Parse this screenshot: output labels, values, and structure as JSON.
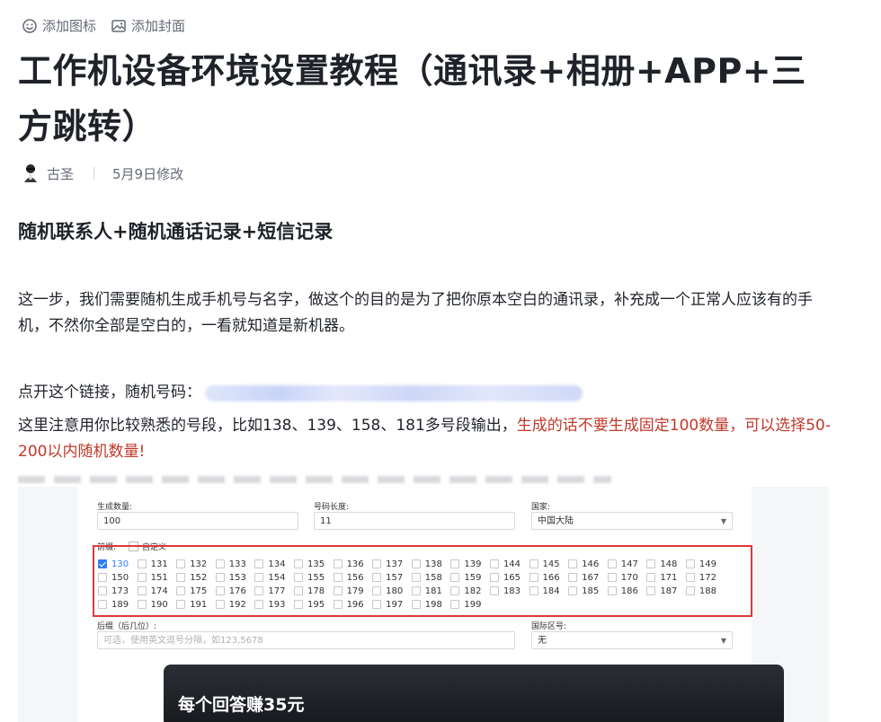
{
  "top_actions": {
    "add_icon": "添加图标",
    "add_cover": "添加封面"
  },
  "article": {
    "title": "工作机设备环境设置教程（通讯录+相册+APP+三方跳转）",
    "author": "古圣",
    "modified": "5月9日修改",
    "section_heading": "随机联系人+随机通话记录+短信记录",
    "para1": "这一步，我们需要随机生成手机号与名字，做这个的目的是为了把你原本空白的通讯录，补充成一个正常人应该有的手机，不然你全部是空白的，一看就知道是新机器。",
    "para2_prefix": "点开这个链接，随机号码：",
    "para3_normal": "这里注意用你比较熟悉的号段，比如138、139、158、181多号段输出，",
    "para3_red": "生成的话不要生成固定100数量，可以选择50-200以内随机数量!"
  },
  "form": {
    "count_label": "生成数量:",
    "count_value": "100",
    "length_label": "号码长度:",
    "length_value": "11",
    "country_label": "国家:",
    "country_value": "中国大陆",
    "prefix_label": "前缀:",
    "custom_label": "自定义",
    "prefixes": [
      "130",
      "131",
      "132",
      "133",
      "134",
      "135",
      "136",
      "137",
      "138",
      "139",
      "144",
      "145",
      "146",
      "147",
      "148",
      "149",
      "150",
      "151",
      "152",
      "153",
      "154",
      "155",
      "156",
      "157",
      "158",
      "159",
      "165",
      "166",
      "167",
      "170",
      "171",
      "172",
      "173",
      "174",
      "175",
      "176",
      "177",
      "178",
      "179",
      "180",
      "181",
      "182",
      "183",
      "184",
      "185",
      "186",
      "187",
      "188",
      "189",
      "190",
      "191",
      "192",
      "193",
      "195",
      "196",
      "197",
      "198",
      "199"
    ],
    "checked_prefix": "130",
    "suffix_label": "后缀（后几位）:",
    "suffix_placeholder": "可选，使用英文逗号分隔，如123,5678",
    "intl_label": "国际区号:",
    "intl_value": "无"
  },
  "promo": {
    "text": "每个回答赚35元"
  }
}
